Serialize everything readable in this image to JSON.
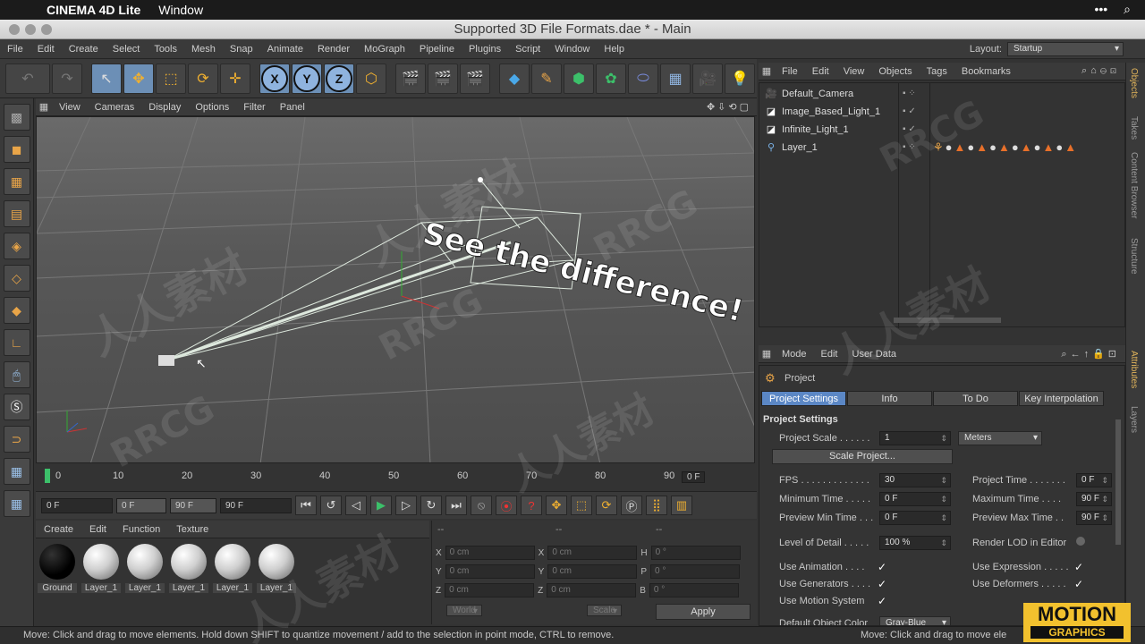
{
  "mac_menu": {
    "app_name": "CINEMA 4D Lite",
    "window_menu": "Window"
  },
  "title": "Supported 3D File Formats.dae * - Main",
  "menubar": [
    "File",
    "Edit",
    "Create",
    "Select",
    "Tools",
    "Mesh",
    "Snap",
    "Animate",
    "Render",
    "MoGraph",
    "Pipeline",
    "Plugins",
    "Script",
    "Window",
    "Help"
  ],
  "layout": {
    "label": "Layout:",
    "value": "Startup"
  },
  "toolbar": {
    "axis_x": "X",
    "axis_y": "Y",
    "axis_z": "Z"
  },
  "viewport": {
    "menu": [
      "View",
      "Cameras",
      "Display",
      "Options",
      "Filter",
      "Panel"
    ],
    "scene_text": "See the difference!"
  },
  "timeline": {
    "ticks": [
      "0",
      "10",
      "20",
      "30",
      "40",
      "50",
      "60",
      "70",
      "80",
      "90"
    ],
    "current_frame": "0 F"
  },
  "transport": {
    "start": "0 F",
    "range_min": "0 F",
    "range_max": "90 F",
    "end": "90 F"
  },
  "materials": {
    "menu": [
      "Create",
      "Edit",
      "Function",
      "Texture"
    ],
    "items": [
      "Ground",
      "Layer_1",
      "Layer_1",
      "Layer_1",
      "Layer_1",
      "Layer_1"
    ]
  },
  "coordinates": {
    "headers": [
      "--",
      "--",
      "--"
    ],
    "rows": [
      {
        "a": "X",
        "av": "0 cm",
        "b": "X",
        "bv": "0 cm",
        "c": "H",
        "cv": "0 °"
      },
      {
        "a": "Y",
        "av": "0 cm",
        "b": "Y",
        "bv": "0 cm",
        "c": "P",
        "cv": "0 °"
      },
      {
        "a": "Z",
        "av": "0 cm",
        "b": "Z",
        "bv": "0 cm",
        "c": "B",
        "cv": "0 °"
      }
    ],
    "world_label": "World",
    "scale_label": "Scale",
    "apply_label": "Apply"
  },
  "objects": {
    "menu": [
      "File",
      "Edit",
      "View",
      "Objects",
      "Tags",
      "Bookmarks"
    ],
    "items": [
      "Default_Camera",
      "Image_Based_Light_1",
      "Infinite_Light_1",
      "Layer_1"
    ]
  },
  "attributes": {
    "menu": [
      "Mode",
      "Edit",
      "User Data"
    ],
    "object": "Project",
    "tabs": [
      "Project Settings",
      "Info",
      "To Do",
      "Key Interpolation"
    ],
    "section": "Project Settings",
    "project_scale_label": "Project Scale . . . . . .",
    "project_scale": "1",
    "project_scale_unit": "Meters",
    "scale_button": "Scale Project...",
    "fps_label": "FPS . . . . . . . . . . . . .",
    "fps": "30",
    "project_time_label": "Project Time . . . . . . .",
    "project_time": "0 F",
    "min_time_label": "Minimum Time . . . . .",
    "min_time": "0 F",
    "max_time_label": "Maximum Time . . . .",
    "max_time": "90 F",
    "preview_min_label": "Preview Min Time . . .",
    "preview_min": "0 F",
    "preview_max_label": "Preview Max Time . .",
    "preview_max": "90 F",
    "lod_label": "Level of Detail . . . . .",
    "lod": "100 %",
    "render_lod_label": "Render LOD in Editor",
    "use_animation": "Use Animation . . . .",
    "use_expression": "Use Expression . . . . .",
    "use_generators": "Use Generators . . . .",
    "use_deformers": "Use Deformers . . . . .",
    "use_motion": "Use Motion System",
    "default_color_label": "Default Object Color",
    "default_color": "Gray-Blue"
  },
  "side_tabs": [
    "Objects",
    "Takes",
    "Content Browser",
    "Structure"
  ],
  "side_tabs_lower": [
    "Attributes",
    "Layers"
  ],
  "status": "Move: Click and drag to move elements. Hold down SHIFT to quantize movement / add to the selection in point mode, CTRL to remove.",
  "status_right": "Move: Click and drag to move ele",
  "logo": {
    "line1": "MOTION",
    "line2": "GRAPHICS"
  },
  "watermarks": [
    "人人素材",
    "RRCG"
  ],
  "colors": {
    "accent": "#5b87c5",
    "logo": "#f2c12e"
  }
}
